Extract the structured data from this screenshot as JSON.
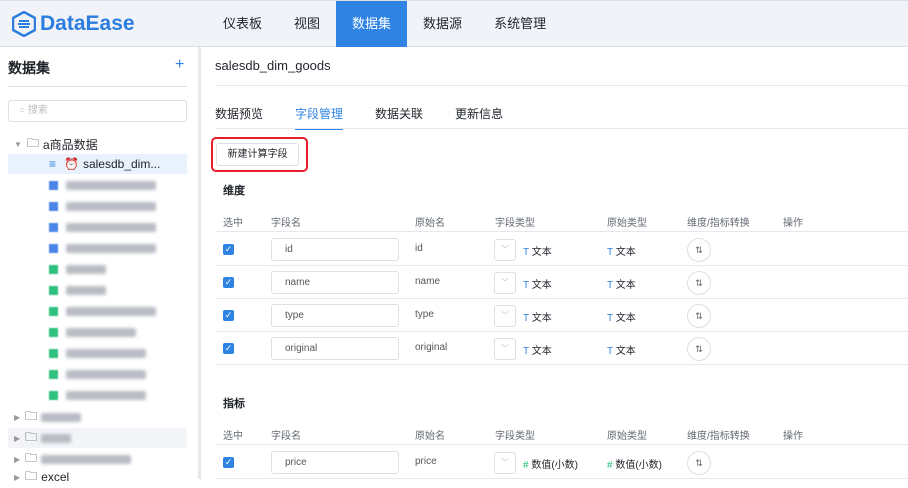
{
  "app": {
    "name": "DataEase"
  },
  "nav": [
    "仪表板",
    "视图",
    "数据集",
    "数据源",
    "系统管理"
  ],
  "sidebar": {
    "title": "数据集",
    "add": "+",
    "search_placeholder": "搜索",
    "root_folder": "a商品数据",
    "selected_item": "salesdb_dim...",
    "last_folder": "excel"
  },
  "main": {
    "title": "salesdb_dim_goods",
    "tabs": [
      "数据预览",
      "字段管理",
      "数据关联",
      "更新信息"
    ],
    "new_calc_button": "新建计算字段",
    "dim_section": "维度",
    "measure_section": "指标",
    "columns": [
      "选中",
      "字段名",
      "原始名",
      "字段类型",
      "原始类型",
      "维度/指标转换",
      "操作"
    ],
    "dim_rows": [
      {
        "name": "id",
        "orig": "id",
        "type": "文本",
        "otype": "文本"
      },
      {
        "name": "name",
        "orig": "name",
        "type": "文本",
        "otype": "文本"
      },
      {
        "name": "type",
        "orig": "type",
        "type": "文本",
        "otype": "文本"
      },
      {
        "name": "original",
        "orig": "original",
        "type": "文本",
        "otype": "文本"
      }
    ],
    "measure_rows": [
      {
        "name": "price",
        "orig": "price",
        "type": "数值(小数)",
        "otype": "数值(小数)"
      }
    ]
  }
}
